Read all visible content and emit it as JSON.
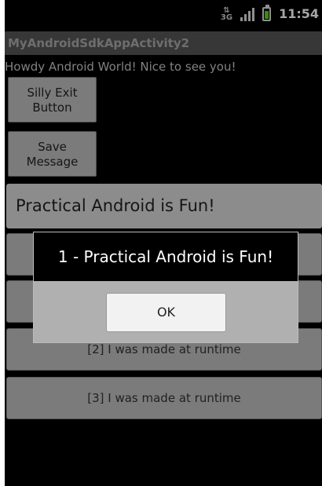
{
  "status_bar": {
    "network": "3G",
    "time": "11:54"
  },
  "app": {
    "title": "MyAndroidSdkAppActivity2"
  },
  "main": {
    "greeting": "Howdy Android World! Nice to see you!",
    "silly_exit_label": "Silly Exit\nButton",
    "save_message_label": "Save\nMessage",
    "message_input_value": "Practical Android is Fun!",
    "runtime_buttons": [
      "",
      "",
      "[2] I was made at runtime",
      "[3] I was made at runtime"
    ]
  },
  "dialog": {
    "message": "1 - Practical Android is Fun!",
    "ok_label": "OK"
  }
}
